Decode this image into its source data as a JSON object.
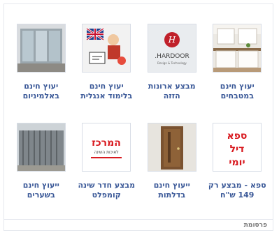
{
  "ads": [
    {
      "label": "יעוץ חינם במטבחים",
      "image": "kitchen-photo"
    },
    {
      "label": "מבצע ארונות הזזה",
      "image": "hardoor-logo",
      "logo_text": "HARDOOR.",
      "logo_sub": "Design & Technology"
    },
    {
      "label": "יעוץ חינם בלימוד אנגלית",
      "image": "english-learning-illustration"
    },
    {
      "label": "יעוץ חינם באלמיניום",
      "image": "aluminium-window-photo"
    },
    {
      "label": "ספא - מבצע רק 149 ש\"ח",
      "image": "spa-deal-logo",
      "logo_lines": [
        "ספא",
        "דיל",
        "יומי"
      ]
    },
    {
      "label": "ייעוץ חינם בדלתות",
      "image": "door-photo"
    },
    {
      "label": "מבצע חדר שינה קומפלט",
      "image": "hamerkaz-logo",
      "logo_text": "המרכז",
      "logo_sub": "לאיכות השינה"
    },
    {
      "label": "ייעוץ חינם בשערים",
      "image": "gate-photo"
    }
  ],
  "footer": {
    "label": "פרסומת"
  },
  "colors": {
    "link": "#3b5998",
    "border": "#e5e8ee"
  }
}
